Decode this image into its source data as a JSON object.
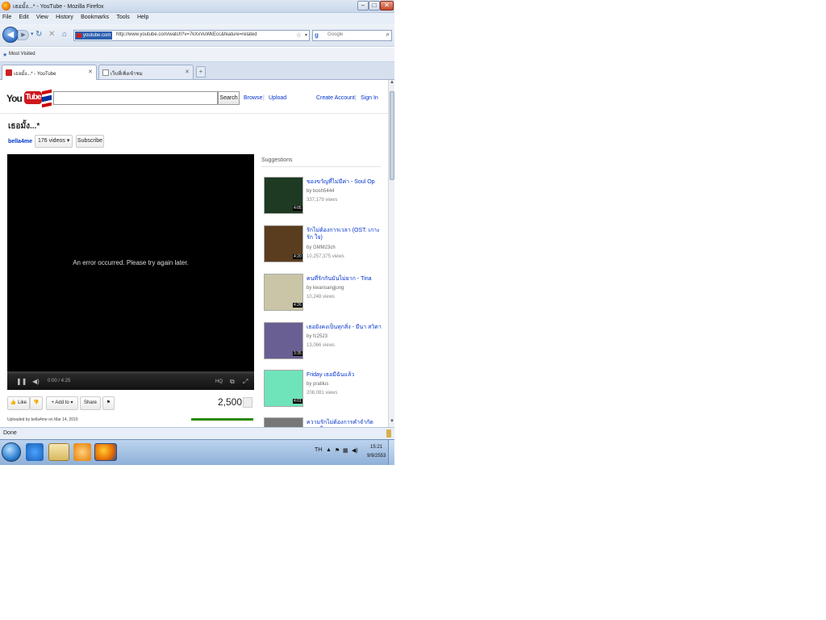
{
  "window": {
    "title": "เธอมั้ง...* - YouTube - Mozilla Firefox"
  },
  "menu": [
    "File",
    "Edit",
    "View",
    "History",
    "Bookmarks",
    "Tools",
    "Help"
  ],
  "nav": {
    "site_badge": "youtube.com",
    "url": "http://www.youtube.com/watch?v=7kXxVuWkEcc&feature=related",
    "search_placeholder": "Google"
  },
  "bookmarks": {
    "most_visited": "Most Visited"
  },
  "tabs": [
    {
      "title": "เธอมั้ง...* - YouTube",
      "active": true
    },
    {
      "title": "เว็บที่เพิ่งเข้าชม",
      "active": false
    }
  ],
  "youtube": {
    "logo_you": "You",
    "logo_tube": "Tube",
    "search_button": "Search",
    "browse": "Browse",
    "upload": "Upload",
    "create_account": "Create Account",
    "sign_in": "Sign In"
  },
  "video": {
    "title": "เธอมั้ง...*",
    "channel": "bella4me",
    "videos_count": "176 videos",
    "subscribe": "Subscribe",
    "error_message": "An error occurred. Please try again later.",
    "time": "0:00 / 4:25",
    "like": "Like",
    "add_to": "Add to",
    "share": "Share",
    "view_count": "2,500",
    "uploaded": "Uploaded by bella4me on Mar 14, 2010"
  },
  "suggestions": {
    "header": "Suggestions",
    "items": [
      {
        "title": "ของขวัญที่ไม่มีค่า - Soul Op",
        "by": "by bosh5444",
        "views": "337,179 views",
        "duration": "4:05",
        "thumb_color": "#1f3a22"
      },
      {
        "title": "รักไม่ต้องการเวลา (OST. เกาะรัก ใจ)",
        "by": "by GMM23ch",
        "views": "10,257,375 views",
        "duration": "4:20",
        "thumb_color": "#5a3d1e"
      },
      {
        "title": "คนที่รักกันมันไม่ยาก - Tina",
        "by": "by kwansangjung",
        "views": "10,248 views",
        "duration": "4:26",
        "thumb_color": "#c9c5a6"
      },
      {
        "title": "เธอยังคงเป็นทุกสิ่ง - มีนา สวิตา",
        "by": "by fc2523",
        "views": "13,066 views",
        "duration": "3:35",
        "thumb_color": "#6a5f93"
      },
      {
        "title": "Friday เธอมีฉันแล้ว",
        "by": "by pratilus",
        "views": "208,081 views",
        "duration": "4:01",
        "thumb_color": "#6fe3b9"
      },
      {
        "title": "ความรักไม่ต้องการคำจำกัดความใดๆ",
        "by": "",
        "views": "",
        "duration": "",
        "thumb_color": "#777777"
      }
    ]
  },
  "status": {
    "text": "Done"
  },
  "taskbar": {
    "time": "15:21",
    "date": "9/9/2553",
    "tray": "TH"
  },
  "colors": {
    "link": "#0033cc",
    "youtube_red": "#cc181e",
    "rating_green": "#2a8a00"
  }
}
